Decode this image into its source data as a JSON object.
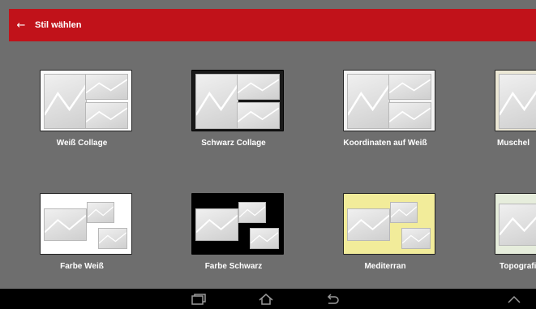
{
  "appbar": {
    "back_icon": "arrow-left-icon",
    "title": "Stil wählen",
    "color": "#c1121a"
  },
  "styles": [
    {
      "label": "Weiß Collage",
      "theme": "white-collage"
    },
    {
      "label": "Schwarz Collage",
      "theme": "black-collage"
    },
    {
      "label": "Koordinaten auf Weiß",
      "theme": "coordinates-white"
    },
    {
      "label": "Muschel",
      "theme": "shell"
    },
    {
      "label": "Farbe Weiß",
      "theme": "color-white"
    },
    {
      "label": "Farbe Schwarz",
      "theme": "color-black"
    },
    {
      "label": "Mediterran",
      "theme": "mediterranean"
    },
    {
      "label": "Topografie",
      "theme": "topography"
    }
  ],
  "navbar": {
    "icons": [
      "recent-apps-icon",
      "home-icon",
      "back-icon",
      "chevron-up-icon"
    ]
  }
}
